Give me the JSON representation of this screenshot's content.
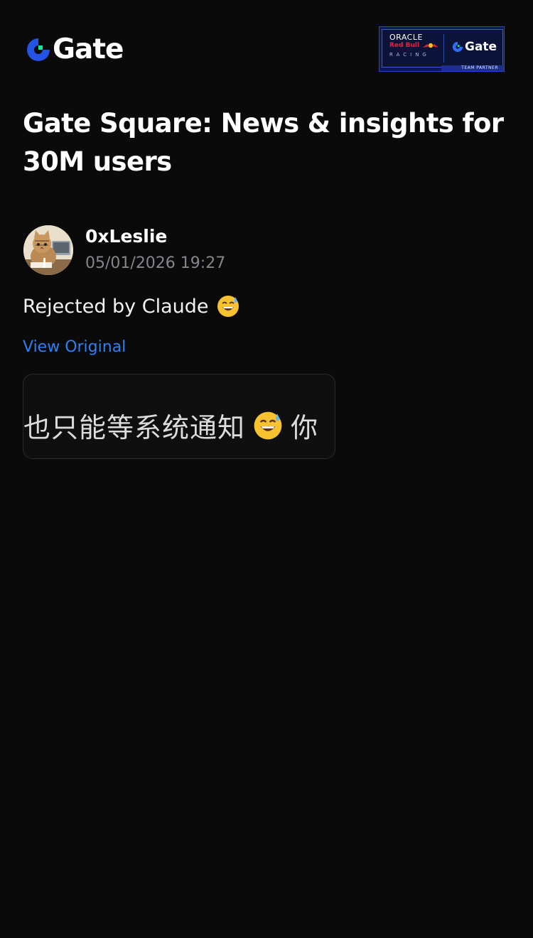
{
  "header": {
    "brand": "Gate",
    "partner_badge": {
      "oracle": "ORACLE",
      "redbull": "Red Bull",
      "racing": "RACING",
      "gate": "Gate",
      "team_partner": "TEAM PARTNER"
    }
  },
  "page": {
    "title": "Gate Square: News & insights for 30M users"
  },
  "post": {
    "author": "0xLeslie",
    "timestamp": "05/01/2026 19:27",
    "text": "Rejected by Claude",
    "text_emoji": "sweat-smile-emoji",
    "view_original_label": "View Original",
    "image_preview": {
      "text_before": "也只能等系统通知",
      "text_after": "你"
    }
  },
  "colors": {
    "background": "#0a0a0b",
    "link": "#2f7ff0",
    "muted_text": "#84868c",
    "brand_blue": "#2354e6",
    "brand_green": "#17e6a1"
  }
}
